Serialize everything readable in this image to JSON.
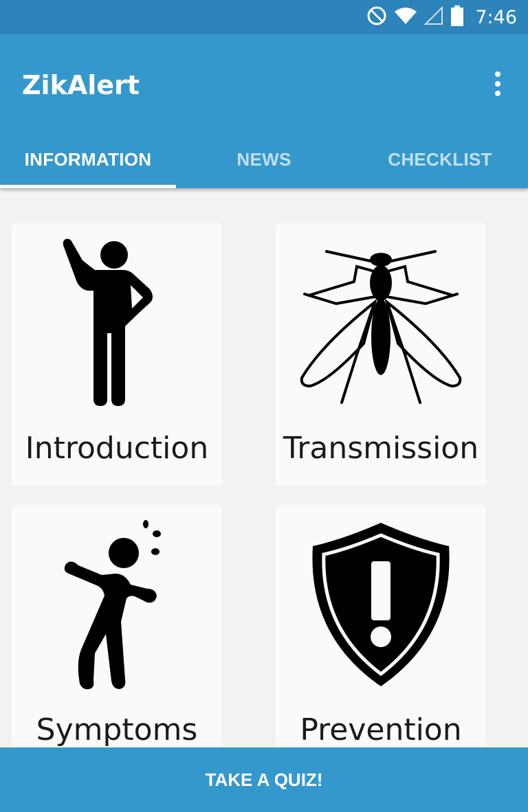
{
  "status_bar": {
    "time": "7:46",
    "icons": [
      "do-not-disturb-icon",
      "wifi-icon",
      "cell-signal-icon",
      "battery-icon"
    ]
  },
  "app_bar": {
    "title": "ZikAlert",
    "menu_icon": "overflow-menu-icon"
  },
  "tabs": [
    {
      "label": "INFORMATION",
      "active": true
    },
    {
      "label": "NEWS",
      "active": false
    },
    {
      "label": "CHECKLIST",
      "active": false
    }
  ],
  "cards": [
    {
      "label": "Introduction",
      "icon": "person-waving-icon"
    },
    {
      "label": "Transmission",
      "icon": "mosquito-icon"
    },
    {
      "label": "Symptoms",
      "icon": "dizzy-person-icon"
    },
    {
      "label": "Prevention",
      "icon": "warning-shield-icon"
    }
  ],
  "bottom_button": {
    "label": "TAKE A QUIZ!"
  },
  "colors": {
    "status_bar": "#2c84bb",
    "primary": "#3598cd",
    "background": "#f2f2f2",
    "card": "#fafafa"
  }
}
